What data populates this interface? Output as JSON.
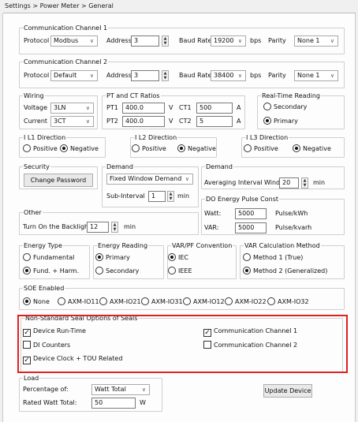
{
  "breadcrumb": "Settings > Power Meter > General",
  "comm1": {
    "legend": "Communication Channel 1",
    "protocol_label": "Protocol",
    "protocol": "Modbus",
    "address_label": "Address",
    "address": "3",
    "baud_label": "Baud Rate",
    "baud": "19200",
    "bps": "bps",
    "parity_label": "Parity",
    "parity": "None 1"
  },
  "comm2": {
    "legend": "Communication Channel 2",
    "protocol_label": "Protocol",
    "protocol": "Default",
    "address_label": "Address",
    "address": "3",
    "baud_label": "Baud Rate",
    "baud": "38400",
    "bps": "bps",
    "parity_label": "Parity",
    "parity": "None 1"
  },
  "wiring": {
    "legend": "Wiring",
    "voltage_label": "Voltage",
    "voltage": "3LN",
    "current_label": "Current",
    "current": "3CT"
  },
  "ratios": {
    "legend": "PT and CT Ratios",
    "pt1_label": "PT1",
    "pt1": "400.0",
    "pt1_unit": "V",
    "ct1_label": "CT1",
    "ct1": "500",
    "ct1_unit": "A",
    "pt2_label": "PT2",
    "pt2": "400.0",
    "pt2_unit": "V",
    "ct2_label": "CT2",
    "ct2": "5",
    "ct2_unit": "A"
  },
  "realtime": {
    "legend": "Real-Time Reading",
    "secondary": "Secondary",
    "primary": "Primary",
    "selected": "primary"
  },
  "l1": {
    "legend": "I L1 Direction",
    "positive": "Positive",
    "negative": "Negative",
    "selected": "negative"
  },
  "l2": {
    "legend": "I L2 Direction",
    "positive": "Positive",
    "negative": "Negative",
    "selected": "negative"
  },
  "l3": {
    "legend": "I L3 Direction",
    "positive": "Positive",
    "negative": "Negative",
    "selected": "negative"
  },
  "security": {
    "legend": "Security",
    "button": "Change Password"
  },
  "demand": {
    "legend": "Demand",
    "mode": "Fixed Window Demand",
    "sub_label": "Sub-Interval",
    "sub_value": "1",
    "sub_unit": "min"
  },
  "demand2": {
    "legend": "Demand",
    "avg_label": "Averaging Interval Window",
    "avg_value": "20",
    "avg_unit": "min"
  },
  "do_const": {
    "legend": "DO Energy Pulse Const",
    "watt_label": "Watt:",
    "watt_value": "5000",
    "watt_unit": "Pulse/kWh",
    "var_label": "VAR:",
    "var_value": "5000",
    "var_unit": "Pulse/kvarh"
  },
  "other": {
    "legend": "Other",
    "backlight_label": "Turn On the Backlight",
    "backlight_value": "12",
    "backlight_unit": "min"
  },
  "energy_type": {
    "legend": "Energy Type",
    "fundamental": "Fundamental",
    "fund_harm": "Fund. + Harm.",
    "selected": "fund_harm"
  },
  "energy_reading": {
    "legend": "Energy Reading",
    "primary": "Primary",
    "secondary": "Secondary",
    "selected": "primary"
  },
  "varpf": {
    "legend": "VAR/PF Convention",
    "iec": "IEC",
    "ieee": "IEEE",
    "selected": "iec"
  },
  "varcalc": {
    "legend": "VAR Calculation Method",
    "m1": "Method 1 (True)",
    "m2": "Method 2 (Generalized)",
    "selected": "m2"
  },
  "soe": {
    "legend": "SOE Enabled",
    "options": [
      "None",
      "AXM-IO11",
      "AXM-IO21",
      "AXM-IO31",
      "AXM-IO12",
      "AXM-IO22",
      "AXM-IO32"
    ],
    "selected": "None"
  },
  "seals": {
    "legend": "Non-Standard Seal Options of Seals",
    "items": [
      {
        "label": "Device Run-Time",
        "checked": true
      },
      {
        "label": "DI Counters",
        "checked": false
      },
      {
        "label": "Device Clock + TOU Related",
        "checked": true
      },
      {
        "label": "Communication Channel 1",
        "checked": true
      },
      {
        "label": "Communication Channel 2",
        "checked": false
      }
    ]
  },
  "load": {
    "legend": "Load",
    "pct_label": "Percentage of:",
    "pct_value": "Watt Total",
    "rated_label": "Rated Watt Total:",
    "rated_value": "50",
    "rated_unit": "W"
  },
  "update_button": "Update Device",
  "colors": {
    "highlight": "#e02020",
    "panel": "#fdfdfd",
    "background": "#f0f0f0"
  }
}
